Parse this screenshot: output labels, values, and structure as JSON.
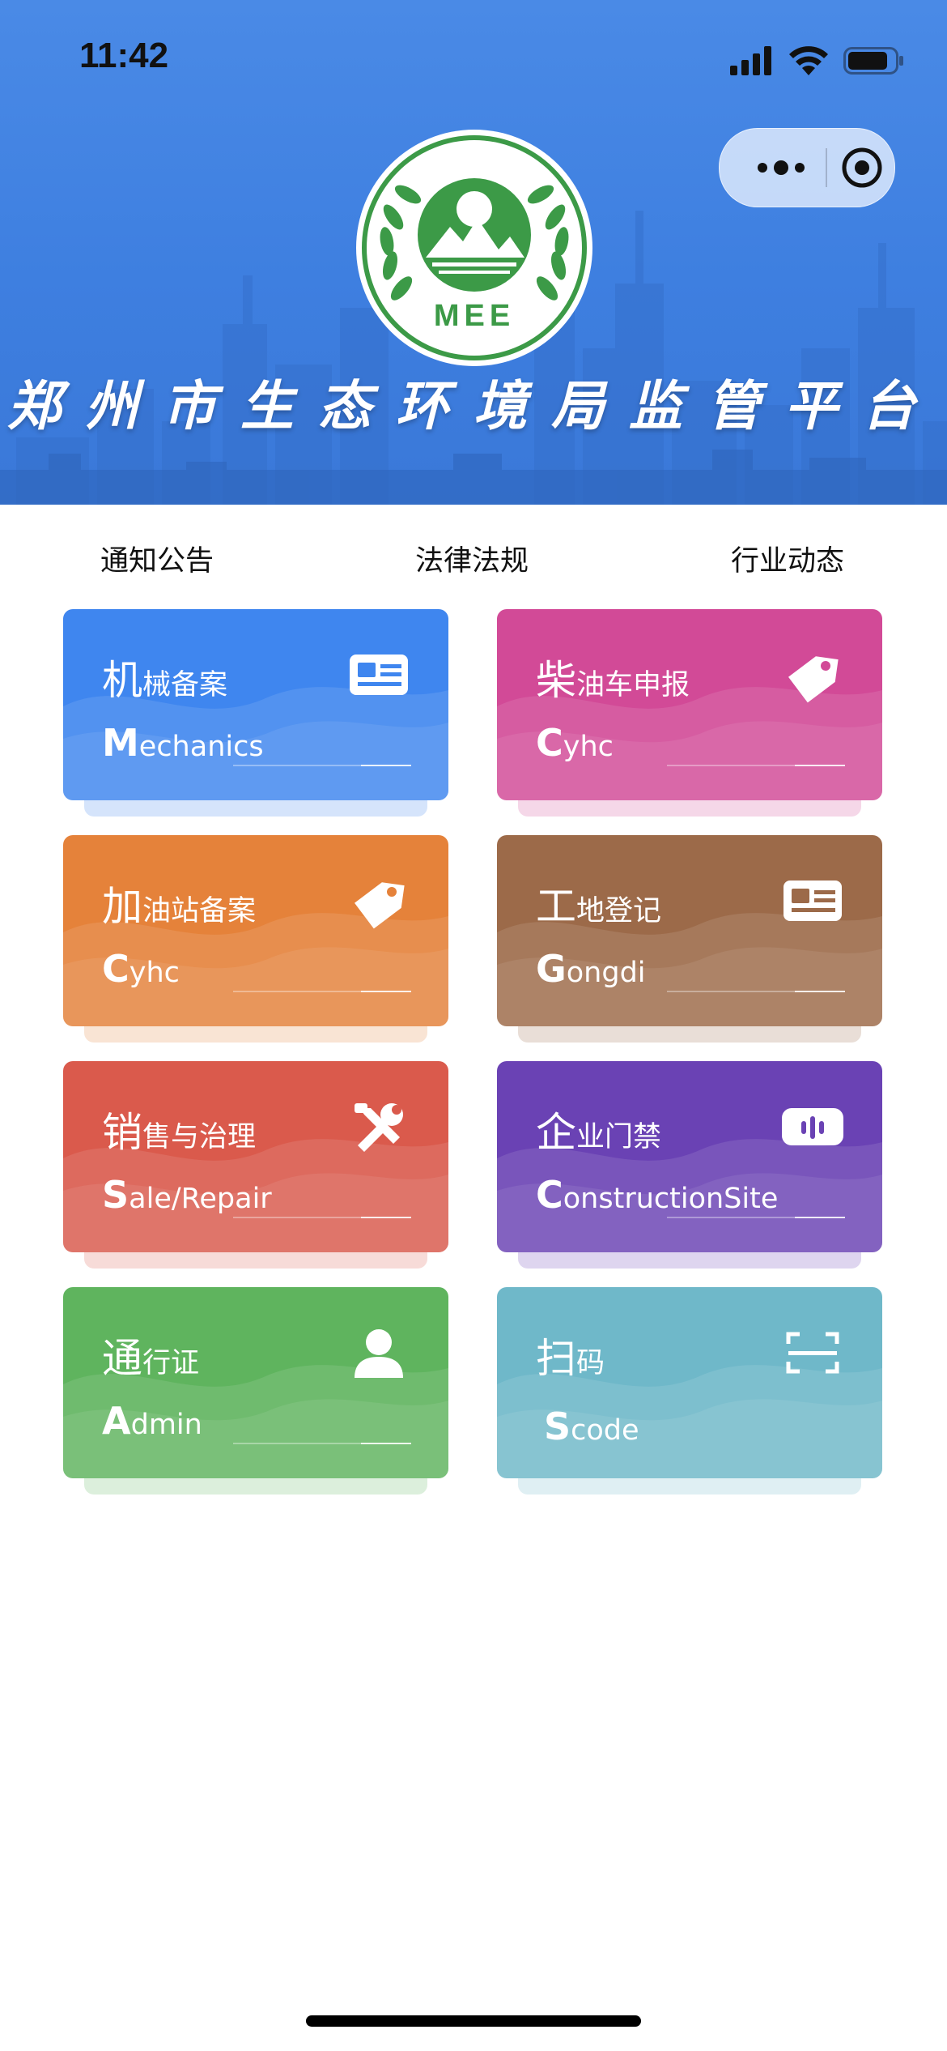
{
  "status": {
    "time": "11:42"
  },
  "header": {
    "title": "郑州市生态环境局监管平台",
    "logo_text": "MEE"
  },
  "tabs": [
    {
      "label": "通知公告"
    },
    {
      "label": "法律法规"
    },
    {
      "label": "行业动态"
    }
  ],
  "cards": [
    {
      "zh_first": "机",
      "zh_rest": "械备案",
      "en_first": "M",
      "en_rest": "echanics",
      "icon": "id-card-icon",
      "color": "#3f86ef"
    },
    {
      "zh_first": "柴",
      "zh_rest": "油车申报",
      "en_first": "C",
      "en_rest": "yhc",
      "icon": "tag-icon",
      "color": "#d24a97"
    },
    {
      "zh_first": "加",
      "zh_rest": "油站备案",
      "en_first": "C",
      "en_rest": "yhc",
      "icon": "tag-icon",
      "color": "#e5823a"
    },
    {
      "zh_first": "工",
      "zh_rest": "地登记",
      "en_first": "G",
      "en_rest": "ongdi",
      "icon": "id-card-icon",
      "color": "#9c6a49"
    },
    {
      "zh_first": "销",
      "zh_rest": "售与治理",
      "en_first": "S",
      "en_rest": "ale/Repair",
      "icon": "tools-icon",
      "color": "#da5a4c"
    },
    {
      "zh_first": "企",
      "zh_rest": "业门禁",
      "en_first": "C",
      "en_rest": "onstructionSite",
      "icon": "voice-icon",
      "color": "#6a42b4"
    },
    {
      "zh_first": "通",
      "zh_rest": "行证",
      "en_first": "A",
      "en_rest": "dmin",
      "icon": "user-icon",
      "color": "#5fb45e"
    },
    {
      "zh_first": "扫",
      "zh_rest": "码",
      "en_first": "S",
      "en_rest": "code",
      "icon": "scan-icon",
      "color": "#6fb8c9"
    }
  ]
}
